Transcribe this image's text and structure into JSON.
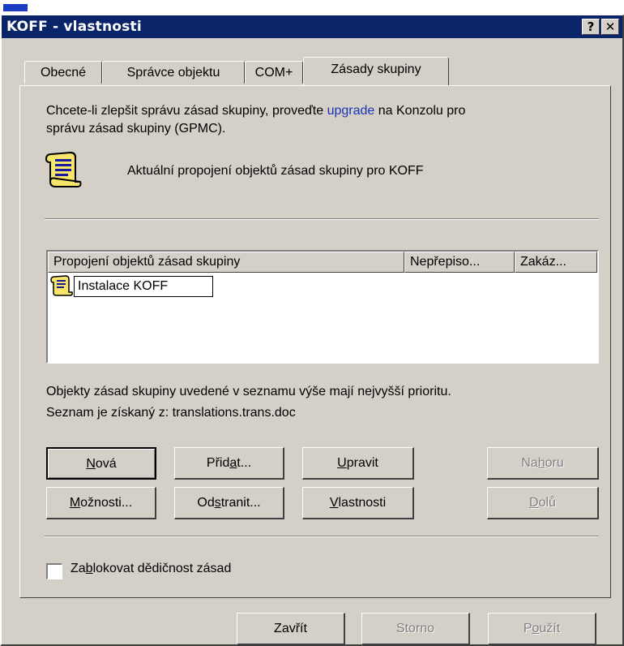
{
  "window": {
    "title": "KOFF - vlastnosti",
    "help_label": "?",
    "close_label": "✕"
  },
  "tabs": [
    {
      "label": "Obecné"
    },
    {
      "label": "Správce objektu"
    },
    {
      "label": "COM+"
    },
    {
      "label": "Zásady skupiny"
    }
  ],
  "intro": {
    "before_link": "Chcete-li zlepšit správu zásad skupiny, proveďte ",
    "link": "upgrade",
    "after_link": " na Konzolu pro",
    "line2": "správu zásad skupiny (GPMC)."
  },
  "current_links_text": "Aktuální propojení objektů zásad skupiny pro KOFF",
  "list": {
    "columns": [
      "Propojení objektů zásad skupiny",
      "Nepřepiso...",
      "Zakáz..."
    ],
    "rows": [
      {
        "name": "Instalace KOFF"
      }
    ]
  },
  "priority_text": {
    "line1": "Objekty zásad skupiny uvedené v seznamu výše mají nejvyšší prioritu.",
    "line2": "Seznam je získaný z: translations.trans.doc"
  },
  "buttons": {
    "new": {
      "pre": "",
      "key": "N",
      "post": "ová"
    },
    "add": {
      "pre": "Přid",
      "key": "a",
      "post": "t..."
    },
    "edit": {
      "pre": "",
      "key": "U",
      "post": "pravit"
    },
    "up": {
      "pre": "Na",
      "key": "h",
      "post": "oru"
    },
    "options": {
      "pre": "",
      "key": "M",
      "post": "ožnosti..."
    },
    "delete": {
      "pre": "Od",
      "key": "s",
      "post": "tranit..."
    },
    "props": {
      "pre": "",
      "key": "V",
      "post": "lastnosti"
    },
    "down": {
      "pre": "",
      "key": "D",
      "post": "olů"
    }
  },
  "block_inheritance": {
    "pre": "Za",
    "key": "b",
    "post": "lokovat dědičnost zásad",
    "checked": false
  },
  "dialog_buttons": {
    "close": "Zavřít",
    "cancel": "Storno",
    "apply": {
      "pre": "P",
      "key": "o",
      "post": "užít"
    }
  },
  "colors": {
    "title_bar": "#0a246a",
    "face": "#d4d0c8",
    "link": "#1a32b8"
  }
}
